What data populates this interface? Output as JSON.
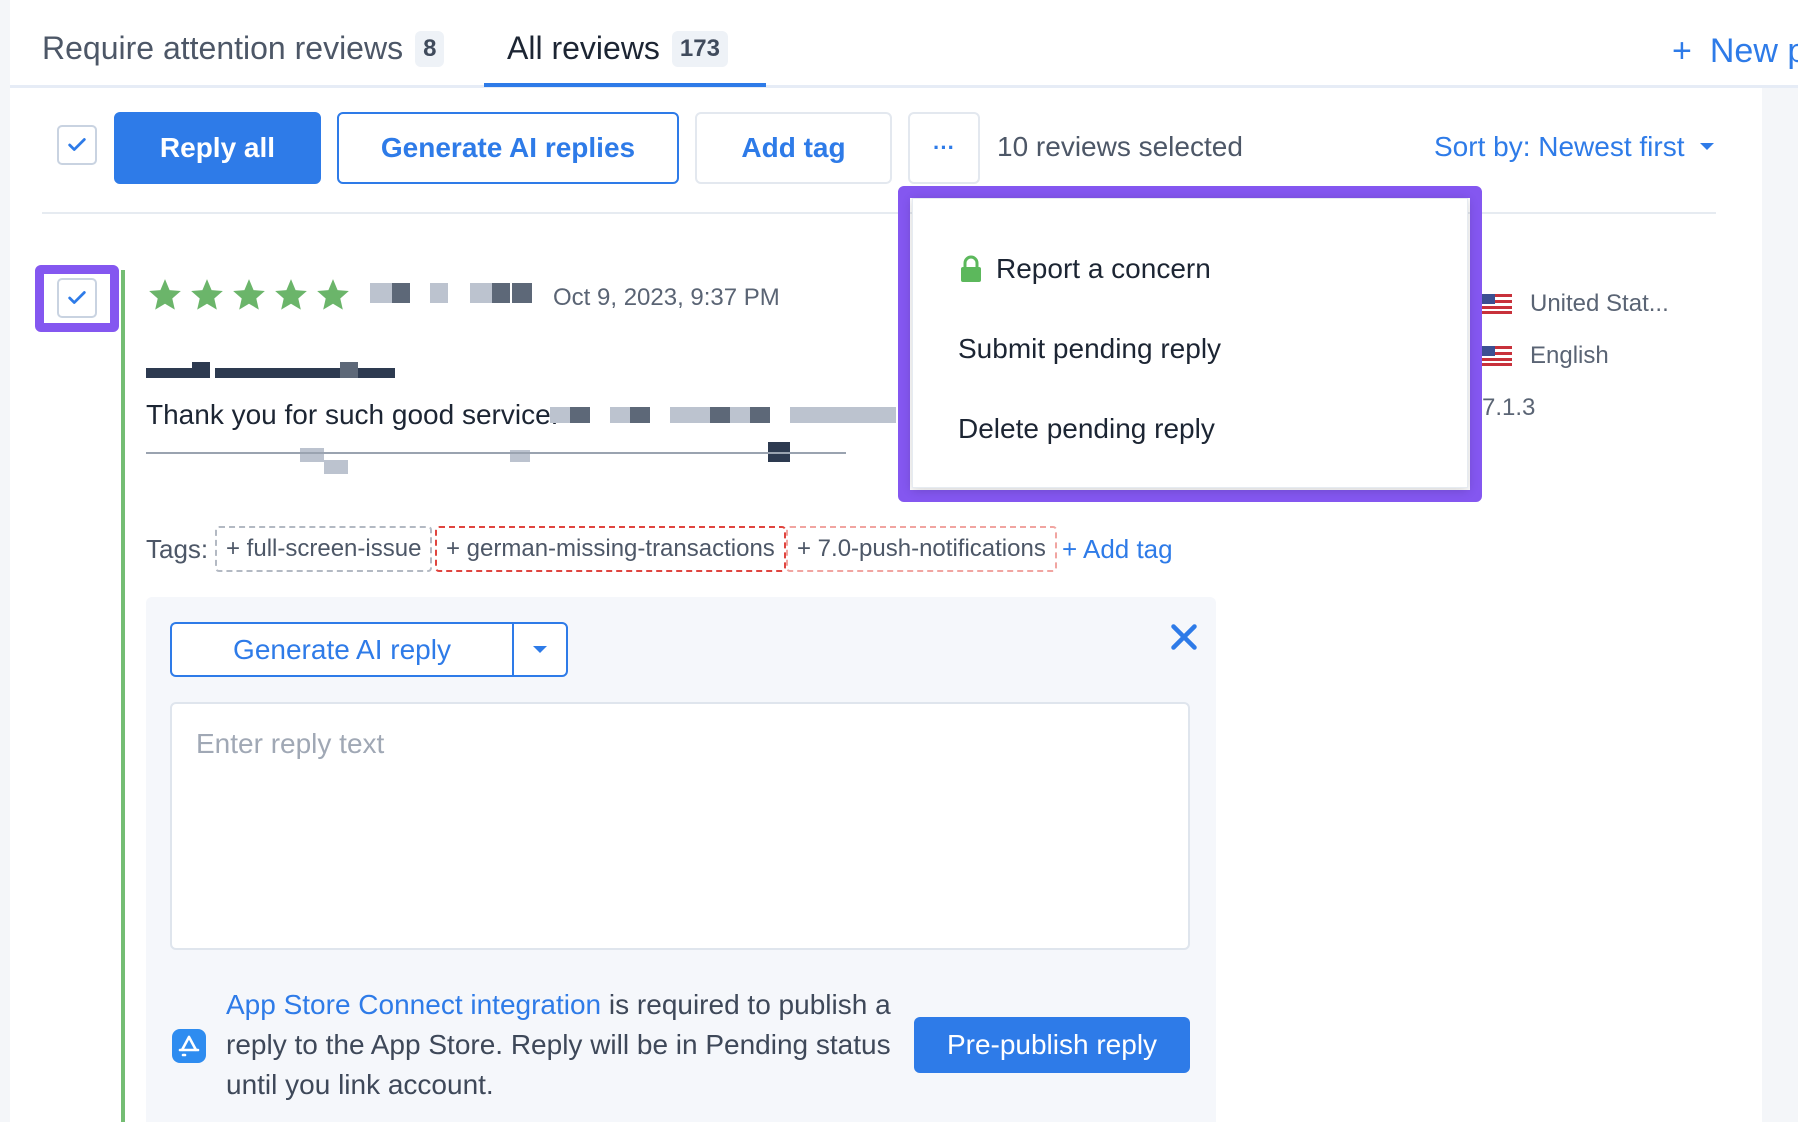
{
  "tabs": {
    "attention_label": "Require attention reviews",
    "attention_count": "8",
    "all_label": "All reviews",
    "all_count": "173",
    "new_label": "New p"
  },
  "toolbar": {
    "reply_all": "Reply all",
    "generate_ai_replies": "Generate AI replies",
    "add_tag": "Add tag",
    "more": "···",
    "selected_text": "10 reviews selected",
    "sort_label": "Sort by: Newest first"
  },
  "dropdown": {
    "items": [
      "Report a concern",
      "Submit pending reply",
      "Delete pending reply"
    ]
  },
  "review": {
    "rating": 5,
    "date": "Oct 9, 2023, 9:37 PM",
    "text": "Thank you for such good service.",
    "country": "United Stat...",
    "language": "English",
    "version": "7.1.3",
    "tags_label": "Tags:",
    "tags": [
      "+ full-screen-issue",
      "+ german-missing-transactions",
      "+ 7.0-push-notifications"
    ],
    "add_tag": "+ Add tag"
  },
  "reply": {
    "generate_ai_reply": "Generate AI reply",
    "placeholder": "Enter reply text",
    "info_link": "App Store Connect integration",
    "info_text": " is required to publish a reply to the App Store. Reply will be in Pending status until you link account.",
    "prepublish": "Pre-publish reply"
  },
  "colors": {
    "accent": "#2e7be8",
    "highlight": "#8457f0",
    "star": "#6bb56a",
    "lock": "#5cb85c"
  }
}
